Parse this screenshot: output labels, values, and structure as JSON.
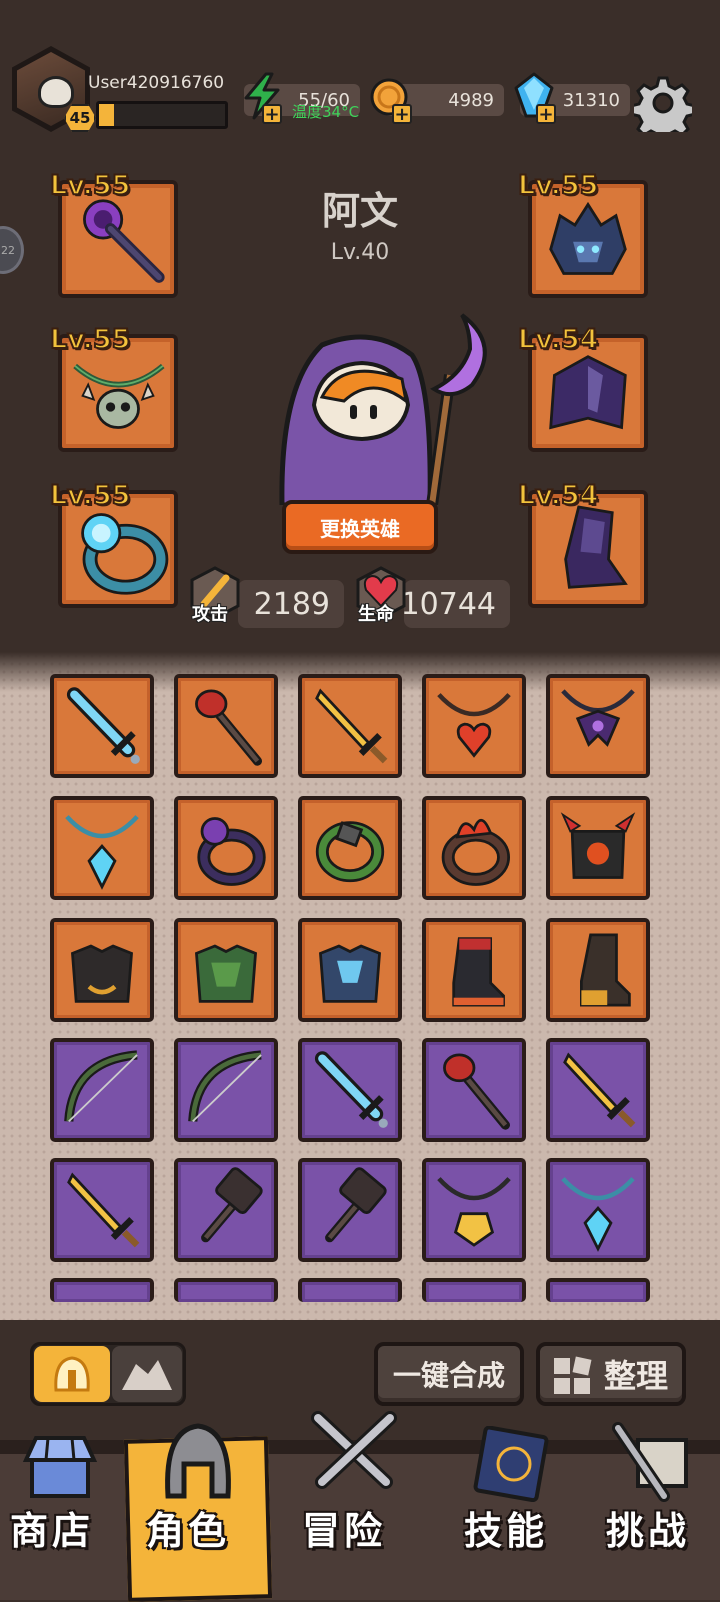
{
  "player": {
    "username": "User420916760",
    "level": "45",
    "xp_progress": 0.12
  },
  "resources": {
    "energy": "55/60",
    "coins": "4989",
    "gems": "31310",
    "temperature_overlay": "温度34°C"
  },
  "hero": {
    "name": "阿文",
    "level": "Lv.40",
    "change_button": "更换英雄",
    "attack_label": "攻击",
    "attack_value": "2189",
    "hp_label": "生命",
    "hp_value": "10744"
  },
  "equipment_slots": [
    {
      "side": "left",
      "level": "Lv.55",
      "item": "staff-icon"
    },
    {
      "side": "left",
      "level": "Lv.55",
      "item": "skull-necklace-icon"
    },
    {
      "side": "left",
      "level": "Lv.55",
      "item": "ring-icon"
    },
    {
      "side": "right",
      "level": "Lv.55",
      "item": "helmet-icon"
    },
    {
      "side": "right",
      "level": "Lv.54",
      "item": "cloak-armor-icon"
    },
    {
      "side": "right",
      "level": "Lv.54",
      "item": "boots-icon"
    }
  ],
  "side_badge": "22",
  "inventory": [
    [
      {
        "rarity": "orange",
        "icon": "ice-sword-icon"
      },
      {
        "rarity": "orange",
        "icon": "fire-staff-icon"
      },
      {
        "rarity": "orange",
        "icon": "gold-sword-icon"
      },
      {
        "rarity": "orange",
        "icon": "heart-amulet-icon"
      },
      {
        "rarity": "orange",
        "icon": "dark-amulet-icon"
      }
    ],
    [
      {
        "rarity": "orange",
        "icon": "crystal-necklace-icon"
      },
      {
        "rarity": "orange",
        "icon": "purple-ring-icon"
      },
      {
        "rarity": "orange",
        "icon": "vine-ring-icon"
      },
      {
        "rarity": "orange",
        "icon": "flame-ring-icon"
      },
      {
        "rarity": "orange",
        "icon": "demon-armor-icon"
      }
    ],
    [
      {
        "rarity": "orange",
        "icon": "black-armor-icon"
      },
      {
        "rarity": "orange",
        "icon": "green-armor-icon"
      },
      {
        "rarity": "orange",
        "icon": "ice-armor-icon"
      },
      {
        "rarity": "orange",
        "icon": "red-boot-icon"
      },
      {
        "rarity": "orange",
        "icon": "leather-boot-icon"
      }
    ],
    [
      {
        "rarity": "purple",
        "icon": "bow-icon"
      },
      {
        "rarity": "purple",
        "icon": "bow-icon"
      },
      {
        "rarity": "purple",
        "icon": "ice-sword-icon"
      },
      {
        "rarity": "purple",
        "icon": "fire-staff-icon"
      },
      {
        "rarity": "purple",
        "icon": "gold-sword-icon"
      }
    ],
    [
      {
        "rarity": "purple",
        "icon": "gold-sword-icon"
      },
      {
        "rarity": "purple",
        "icon": "hammer-icon"
      },
      {
        "rarity": "purple",
        "icon": "hammer-icon"
      },
      {
        "rarity": "purple",
        "icon": "gold-amulet-icon"
      },
      {
        "rarity": "purple",
        "icon": "crystal-necklace-icon"
      }
    ]
  ],
  "controls": {
    "merge_button": "一键合成",
    "sort_button": "整理"
  },
  "nav": [
    {
      "label": "商店",
      "icon": "shop-icon"
    },
    {
      "label": "角色",
      "icon": "helmet-icon",
      "active": true
    },
    {
      "label": "冒险",
      "icon": "crossed-swords-icon"
    },
    {
      "label": "技能",
      "icon": "spellbook-icon"
    },
    {
      "label": "挑战",
      "icon": "sword-flag-icon"
    }
  ],
  "colors": {
    "accent": "#f4b43a",
    "orange_rarity": "#d9783a",
    "purple_rarity": "#7a52a8",
    "button_orange": "#ea6a24"
  }
}
